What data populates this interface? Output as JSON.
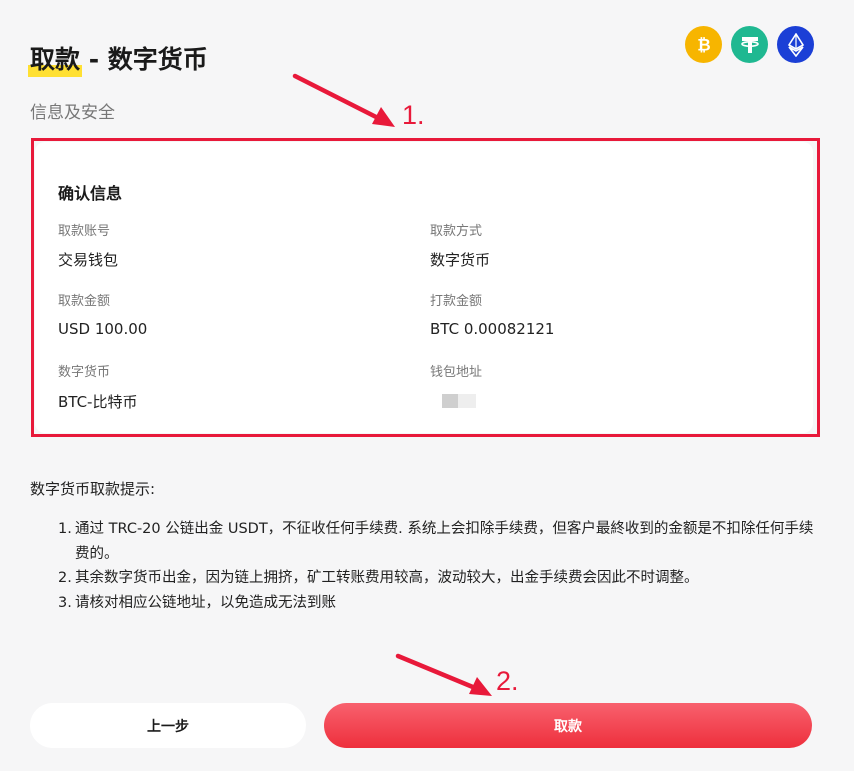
{
  "header": {
    "title_highlight": "取款",
    "title_rest": " - 数字货币",
    "subtitle": "信息及安全"
  },
  "coins": [
    {
      "name": "bitcoin",
      "color": "#f7b500"
    },
    {
      "name": "tether",
      "color": "#1fb891"
    },
    {
      "name": "ethereum",
      "color": "#1b3fd6"
    }
  ],
  "confirm": {
    "title": "确认信息",
    "fields": [
      {
        "label": "取款账号",
        "value": "交易钱包"
      },
      {
        "label": "取款方式",
        "value": "数字货币"
      },
      {
        "label": "取款金额",
        "value": "USD 100.00"
      },
      {
        "label": "打款金额",
        "value": "BTC 0.00082121"
      },
      {
        "label": "数字货币",
        "value": "BTC-比特币"
      },
      {
        "label": "钱包地址",
        "value": ""
      }
    ]
  },
  "tips": {
    "title": "数字货币取款提示:",
    "items": [
      {
        "num": "1.",
        "text": "通过 TRC-20 公链出金 USDT，不征收任何手续费. 系统上会扣除手续费，但客户最終收到的金额是不扣除任何手续费的。"
      },
      {
        "num": "2.",
        "text": "其余数字货币出金，因为链上拥挤，矿工转账费用较高，波动较大，出金手续费会因此不时调整。"
      },
      {
        "num": "3.",
        "text": "请核对相应公链地址，以免造成无法到账"
      }
    ]
  },
  "buttons": {
    "prev_label": "上一步",
    "submit_label": "取款"
  },
  "annotations": {
    "label_1": "1.",
    "label_2": "2.",
    "color": "#e8193a"
  }
}
